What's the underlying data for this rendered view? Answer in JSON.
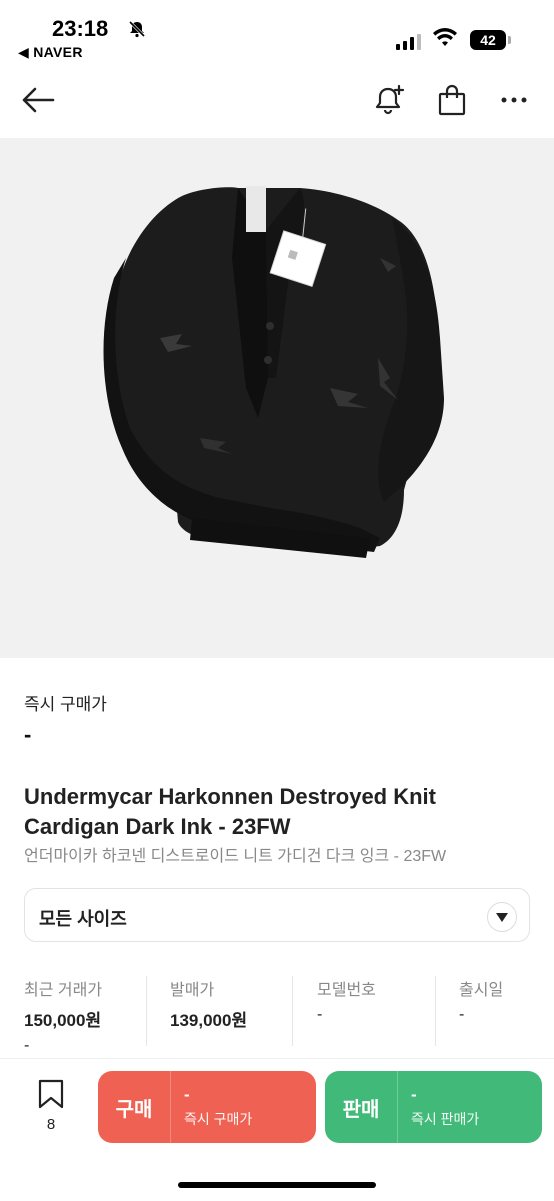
{
  "status_bar": {
    "time": "23:18",
    "back_app": "◀ NAVER",
    "battery": "42"
  },
  "nav": {
    "icons": [
      "back-arrow-icon",
      "bell-plus-icon",
      "shopping-bag-icon",
      "more-icon"
    ]
  },
  "product": {
    "instant_buy_label": "즉시 구매가",
    "instant_buy_price": "-",
    "title_en": "Undermycar Harkonnen Destroyed Knit Cardigan Dark Ink - 23FW",
    "title_ko": "언더마이카 하코넨 디스트로이드 니트 가디건 다크 잉크 - 23FW",
    "size_select": "모든 사이즈"
  },
  "stats": [
    {
      "label": "최근 거래가",
      "value": "150,000원",
      "sub": "-"
    },
    {
      "label": "발매가",
      "value": "139,000원"
    },
    {
      "label": "모델번호",
      "value": "-"
    },
    {
      "label": "출시일",
      "value": "-"
    }
  ],
  "bottom_bar": {
    "bookmark_count": "8",
    "buy": {
      "label": "구매",
      "price": "-",
      "sub": "즉시 구매가"
    },
    "sell": {
      "label": "판매",
      "price": "-",
      "sub": "즉시 판매가"
    }
  },
  "colors": {
    "buy": "#ef6253",
    "sell": "#41b979",
    "image_bg": "#f1f1f1"
  }
}
